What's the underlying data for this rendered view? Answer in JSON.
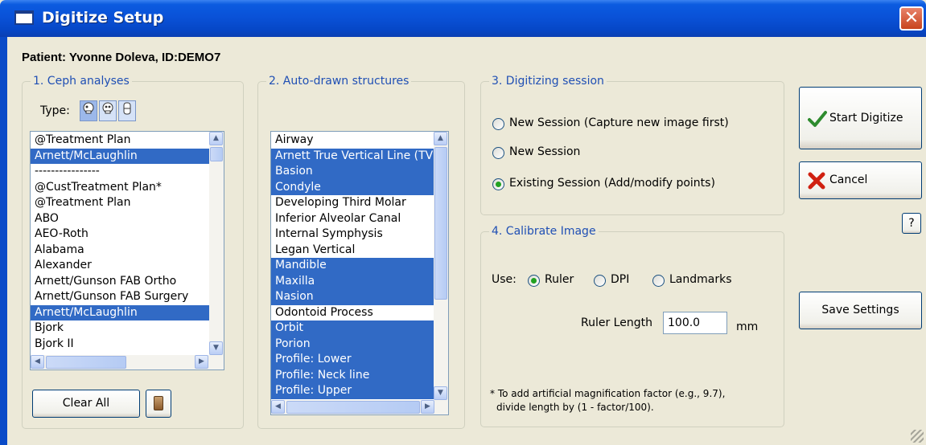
{
  "window": {
    "title": "Digitize Setup",
    "close_glyph": "✕"
  },
  "patient": "Patient: Yvonne Doleva, ID:DEMO7",
  "ceph": {
    "legend": "1. Ceph analyses",
    "type_label": "Type:",
    "type_icons": [
      "skull-side-icon",
      "skull-front-icon",
      "teeth-icon"
    ],
    "items": [
      {
        "label": "@Treatment Plan",
        "selected": false
      },
      {
        "label": "Arnett/McLaughlin",
        "selected": true
      },
      {
        "label": "----------------",
        "selected": false
      },
      {
        "label": "@CustTreatment Plan*",
        "selected": false
      },
      {
        "label": "@Treatment Plan",
        "selected": false
      },
      {
        "label": "ABO",
        "selected": false
      },
      {
        "label": "AEO-Roth",
        "selected": false
      },
      {
        "label": "Alabama",
        "selected": false
      },
      {
        "label": "Alexander",
        "selected": false
      },
      {
        "label": "Arnett/Gunson FAB Ortho",
        "selected": false
      },
      {
        "label": "Arnett/Gunson FAB Surgery",
        "selected": false
      },
      {
        "label": "Arnett/McLaughlin",
        "selected": true
      },
      {
        "label": "Bjork",
        "selected": false
      },
      {
        "label": "Bjork II",
        "selected": false
      }
    ],
    "clear_all": "Clear All"
  },
  "auto": {
    "legend": "2. Auto-drawn structures",
    "items": [
      {
        "label": "Airway",
        "selected": false
      },
      {
        "label": "Arnett True Vertical Line (TVL",
        "selected": true
      },
      {
        "label": "Basion",
        "selected": true
      },
      {
        "label": "Condyle",
        "selected": true
      },
      {
        "label": "Developing Third Molar",
        "selected": false
      },
      {
        "label": "Inferior Alveolar Canal",
        "selected": false
      },
      {
        "label": "Internal Symphysis",
        "selected": false
      },
      {
        "label": "Legan Vertical",
        "selected": false
      },
      {
        "label": "Mandible",
        "selected": true
      },
      {
        "label": "Maxilla",
        "selected": true
      },
      {
        "label": "Nasion",
        "selected": true
      },
      {
        "label": "Odontoid Process",
        "selected": false
      },
      {
        "label": "Orbit",
        "selected": true
      },
      {
        "label": "Porion",
        "selected": true
      },
      {
        "label": "Profile: Lower",
        "selected": true
      },
      {
        "label": "Profile: Neck line",
        "selected": true
      },
      {
        "label": "Profile: Upper",
        "selected": true
      }
    ]
  },
  "session": {
    "legend": "3. Digitizing session",
    "options": [
      {
        "label": "New Session (Capture new image first)",
        "checked": false
      },
      {
        "label": "New Session",
        "checked": false
      },
      {
        "label": "Existing Session (Add/modify points)",
        "checked": true
      }
    ]
  },
  "calibrate": {
    "legend": "4. Calibrate Image",
    "use_label": "Use:",
    "options": [
      {
        "label": "Ruler",
        "checked": true
      },
      {
        "label": "DPI",
        "checked": false
      },
      {
        "label": "Landmarks",
        "checked": false
      }
    ],
    "ruler_length_label": "Ruler Length",
    "ruler_length_value": "100.0",
    "unit": "mm",
    "note_line1": "* To add artificial magnification factor (e.g., 9.7),",
    "note_line2": "divide length by (1 - factor/100)."
  },
  "buttons": {
    "start": "Start Digitize",
    "cancel": "Cancel",
    "help": "?",
    "save": "Save Settings"
  },
  "colors": {
    "selection": "#316AC5",
    "legend": "#1F4FB4",
    "titlebar": "#0A52D8"
  }
}
